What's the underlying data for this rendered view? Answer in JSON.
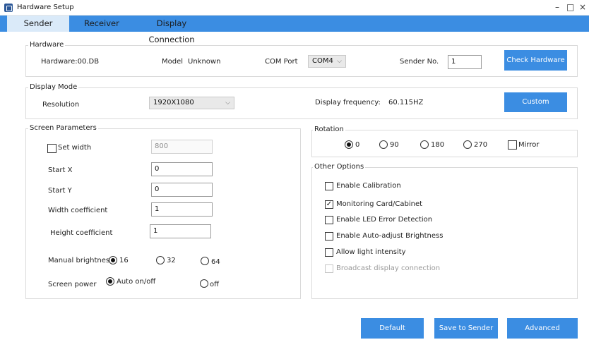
{
  "window": {
    "title": "Hardware Setup",
    "minimize": "–",
    "maximize": "□",
    "close": "×"
  },
  "tabs": [
    "Sender",
    "Receiver",
    "Display Connection"
  ],
  "hardware": {
    "legend": "Hardware",
    "hw_label": "Hardware:00.DB",
    "model_label": "Model",
    "model_value": "Unknown",
    "com_label": "COM Port",
    "com_value": "COM4",
    "sender_label": "Sender No.",
    "sender_value": "1",
    "check_btn": "Check Hardware"
  },
  "display_mode": {
    "legend": "Display Mode",
    "resolution_label": "Resolution",
    "resolution_value": "1920X1080",
    "freq_label": "Display frequency:",
    "freq_value": "60.115HZ",
    "custom_btn": "Custom"
  },
  "screen_params": {
    "legend": "Screen Parameters",
    "set_width_label": "Set width",
    "set_width_value": "800",
    "start_x_label": "Start X",
    "start_x_value": "0",
    "start_y_label": "Start Y",
    "start_y_value": "0",
    "width_coef_label": "Width coefficient",
    "width_coef_value": "1",
    "height_coef_label": "Height coefficient",
    "height_coef_value": "1",
    "brightness_label": "Manual brightness:",
    "brightness_options": [
      "16",
      "32",
      "64"
    ],
    "power_label": "Screen power",
    "power_options": [
      "Auto on/off",
      "off"
    ]
  },
  "rotation": {
    "legend": "Rotation",
    "options": [
      "0",
      "90",
      "180",
      "270"
    ],
    "mirror_label": "Mirror"
  },
  "other_options": {
    "legend": "Other Options",
    "items": [
      "Enable Calibration",
      "Monitoring Card/Cabinet",
      "Enable LED Error Detection",
      "Enable Auto-adjust Brightness",
      "Allow light intensity",
      "Broadcast display connection"
    ]
  },
  "footer": {
    "default_btn": "Default",
    "save_btn": "Save to Sender",
    "advanced_btn": "Advanced"
  },
  "colors": {
    "accent": "#3b8de2",
    "tab_active": "#daeaf9"
  }
}
